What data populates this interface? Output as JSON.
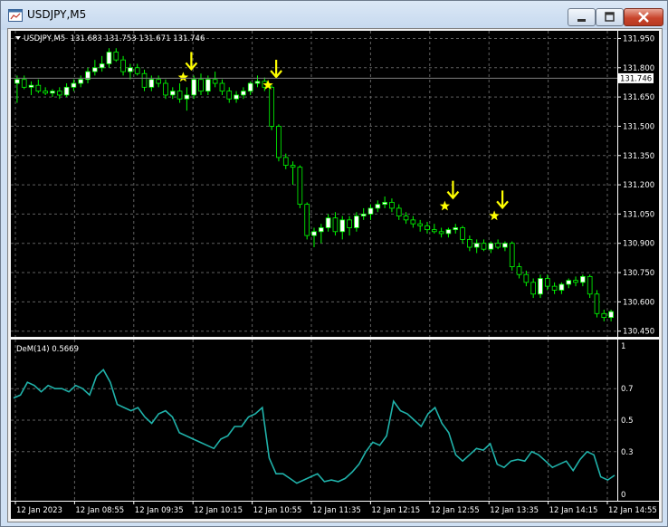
{
  "window": {
    "title": "USDJPY,M5"
  },
  "header": {
    "symbol_line": "USDJPY,M5  131.683 131.753 131.671 131.746"
  },
  "indicator": {
    "label": "DeM(14) 0.5669"
  },
  "colors": {
    "background": "#000000",
    "grid": "#606060",
    "bull_candle": "#ffffff",
    "bear_candle": "#000000",
    "wick": "#00ff00",
    "indicator_line": "#20b2aa",
    "signal": "#ffff00",
    "axis_text": "#ffffff",
    "price_tag_bg": "#ffffff"
  },
  "chart_data": [
    {
      "type": "candlestick",
      "symbol": "USDJPY",
      "timeframe": "M5",
      "current_price_label": "131.746",
      "current_price": 131.746,
      "y_ticks": [
        "131.950",
        "131.800",
        "131.650",
        "131.500",
        "131.350",
        "131.200",
        "131.050",
        "130.900",
        "130.750",
        "130.600",
        "130.450"
      ],
      "ylim": [
        130.43,
        131.98
      ],
      "x_ticks": [
        "12 Jan 2023",
        "12 Jan 08:55",
        "12 Jan 09:35",
        "12 Jan 10:15",
        "12 Jan 10:55",
        "12 Jan 11:35",
        "12 Jan 12:15",
        "12 Jan 12:55",
        "12 Jan 13:35",
        "12 Jan 14:15",
        "12 Jan 14:55"
      ],
      "grid": true,
      "candles": [
        [
          131.72,
          131.76,
          131.62,
          131.74
        ],
        [
          131.74,
          131.76,
          131.69,
          131.7
        ],
        [
          131.7,
          131.73,
          131.66,
          131.71
        ],
        [
          131.71,
          131.74,
          131.67,
          131.68
        ],
        [
          131.68,
          131.7,
          131.66,
          131.67
        ],
        [
          131.67,
          131.69,
          131.65,
          131.68
        ],
        [
          131.68,
          131.7,
          131.64,
          131.66
        ],
        [
          131.66,
          131.72,
          131.65,
          131.7
        ],
        [
          131.7,
          131.74,
          131.68,
          131.72
        ],
        [
          131.72,
          131.76,
          131.7,
          131.74
        ],
        [
          131.74,
          131.8,
          131.72,
          131.78
        ],
        [
          131.78,
          131.84,
          131.76,
          131.8
        ],
        [
          131.8,
          131.86,
          131.78,
          131.82
        ],
        [
          131.82,
          131.9,
          131.8,
          131.88
        ],
        [
          131.88,
          131.9,
          131.83,
          131.84
        ],
        [
          131.84,
          131.86,
          131.76,
          131.78
        ],
        [
          131.78,
          131.82,
          131.74,
          131.8
        ],
        [
          131.8,
          131.82,
          131.76,
          131.77
        ],
        [
          131.77,
          131.79,
          131.68,
          131.7
        ],
        [
          131.7,
          131.76,
          131.68,
          131.74
        ],
        [
          131.74,
          131.76,
          131.7,
          131.72
        ],
        [
          131.72,
          131.74,
          131.64,
          131.66
        ],
        [
          131.66,
          131.7,
          131.64,
          131.68
        ],
        [
          131.68,
          131.72,
          131.62,
          131.64
        ],
        [
          131.64,
          131.7,
          131.58,
          131.66
        ],
        [
          131.66,
          131.76,
          131.64,
          131.74
        ],
        [
          131.74,
          131.77,
          131.66,
          131.68
        ],
        [
          131.68,
          131.76,
          131.66,
          131.74
        ],
        [
          131.74,
          131.78,
          131.7,
          131.72
        ],
        [
          131.72,
          131.74,
          131.66,
          131.68
        ],
        [
          131.68,
          131.7,
          131.62,
          131.64
        ],
        [
          131.64,
          131.68,
          131.62,
          131.66
        ],
        [
          131.66,
          131.7,
          131.64,
          131.68
        ],
        [
          131.68,
          131.73,
          131.66,
          131.72
        ],
        [
          131.72,
          131.76,
          131.7,
          131.73
        ],
        [
          131.73,
          131.75,
          131.68,
          131.7
        ],
        [
          131.7,
          131.71,
          131.48,
          131.5
        ],
        [
          131.5,
          131.51,
          131.32,
          131.34
        ],
        [
          131.34,
          131.36,
          131.28,
          131.3
        ],
        [
          131.3,
          131.32,
          131.2,
          131.29
        ],
        [
          131.29,
          131.3,
          131.08,
          131.1
        ],
        [
          131.1,
          131.11,
          130.92,
          130.94
        ],
        [
          130.94,
          130.98,
          130.88,
          130.96
        ],
        [
          130.96,
          131.0,
          130.9,
          130.98
        ],
        [
          130.98,
          131.05,
          130.96,
          131.03
        ],
        [
          131.03,
          131.06,
          130.94,
          130.96
        ],
        [
          130.96,
          131.04,
          130.92,
          131.02
        ],
        [
          131.02,
          131.04,
          130.94,
          130.98
        ],
        [
          130.98,
          131.06,
          130.96,
          131.04
        ],
        [
          131.04,
          131.08,
          131.02,
          131.05
        ],
        [
          131.05,
          131.1,
          131.02,
          131.08
        ],
        [
          131.08,
          131.12,
          131.06,
          131.1
        ],
        [
          131.1,
          131.14,
          131.08,
          131.11
        ],
        [
          131.11,
          131.13,
          131.06,
          131.08
        ],
        [
          131.08,
          131.1,
          131.02,
          131.04
        ],
        [
          131.04,
          131.06,
          131.0,
          131.02
        ],
        [
          131.02,
          131.04,
          130.98,
          131.0
        ],
        [
          131.0,
          131.02,
          130.96,
          130.99
        ],
        [
          130.99,
          131.01,
          130.95,
          130.97
        ],
        [
          130.97,
          131.0,
          130.95,
          130.96
        ],
        [
          130.96,
          130.98,
          130.93,
          130.95
        ],
        [
          130.95,
          130.98,
          130.93,
          130.97
        ],
        [
          130.97,
          131.0,
          130.95,
          130.98
        ],
        [
          130.98,
          130.99,
          130.9,
          130.92
        ],
        [
          130.92,
          130.94,
          130.86,
          130.88
        ],
        [
          130.88,
          130.92,
          130.85,
          130.9
        ],
        [
          130.9,
          130.92,
          130.86,
          130.87
        ],
        [
          130.87,
          130.91,
          130.85,
          130.9
        ],
        [
          130.9,
          130.92,
          130.87,
          130.88
        ],
        [
          130.88,
          130.91,
          130.86,
          130.9
        ],
        [
          130.9,
          130.91,
          130.76,
          130.78
        ],
        [
          130.78,
          130.8,
          130.72,
          130.74
        ],
        [
          130.74,
          130.76,
          130.68,
          130.7
        ],
        [
          130.7,
          130.72,
          130.62,
          130.64
        ],
        [
          130.64,
          130.74,
          130.62,
          130.72
        ],
        [
          130.72,
          130.74,
          130.66,
          130.68
        ],
        [
          130.68,
          130.7,
          130.64,
          130.66
        ],
        [
          130.66,
          130.7,
          130.64,
          130.69
        ],
        [
          130.69,
          130.72,
          130.67,
          130.71
        ],
        [
          130.71,
          130.73,
          130.68,
          130.7
        ],
        [
          130.7,
          130.74,
          130.68,
          130.73
        ],
        [
          130.73,
          130.74,
          130.62,
          130.64
        ],
        [
          130.64,
          130.66,
          130.52,
          130.54
        ],
        [
          130.54,
          130.56,
          130.5,
          130.52
        ],
        [
          130.52,
          130.56,
          130.5,
          130.55
        ]
      ],
      "signals": [
        {
          "x_index": 24,
          "price": 131.76
        },
        {
          "x_index": 36,
          "price": 131.72
        },
        {
          "x_index": 61,
          "price": 131.1
        },
        {
          "x_index": 68,
          "price": 131.05
        }
      ]
    },
    {
      "type": "line",
      "name": "DeM(14)",
      "y_ticks": [
        "1",
        "0.7",
        "0.5",
        "0.3",
        "0"
      ],
      "ylim": [
        0,
        1
      ],
      "values": [
        0.64,
        0.66,
        0.74,
        0.72,
        0.68,
        0.72,
        0.7,
        0.7,
        0.68,
        0.72,
        0.7,
        0.66,
        0.78,
        0.82,
        0.74,
        0.6,
        0.58,
        0.56,
        0.58,
        0.52,
        0.48,
        0.54,
        0.56,
        0.52,
        0.42,
        0.4,
        0.38,
        0.36,
        0.34,
        0.32,
        0.38,
        0.4,
        0.46,
        0.46,
        0.52,
        0.54,
        0.58,
        0.26,
        0.16,
        0.16,
        0.13,
        0.1,
        0.12,
        0.14,
        0.16,
        0.11,
        0.12,
        0.11,
        0.13,
        0.17,
        0.22,
        0.3,
        0.36,
        0.34,
        0.4,
        0.62,
        0.56,
        0.54,
        0.5,
        0.46,
        0.54,
        0.58,
        0.48,
        0.42,
        0.28,
        0.24,
        0.28,
        0.32,
        0.31,
        0.35,
        0.22,
        0.2,
        0.24,
        0.25,
        0.24,
        0.3,
        0.28,
        0.24,
        0.2,
        0.22,
        0.24,
        0.18,
        0.25,
        0.3,
        0.28,
        0.14,
        0.12,
        0.15
      ]
    }
  ]
}
